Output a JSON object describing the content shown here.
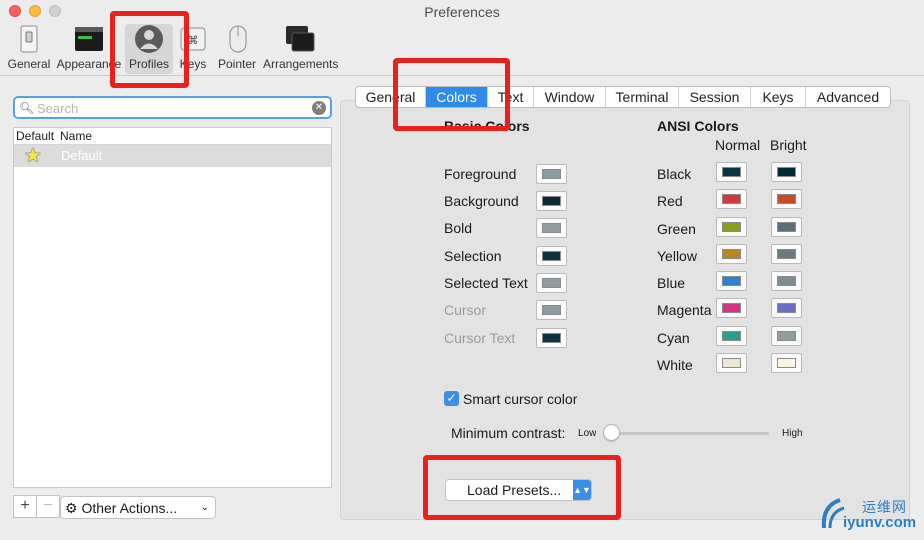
{
  "window": {
    "title": "Preferences"
  },
  "toolbar": {
    "items": [
      {
        "label": "General"
      },
      {
        "label": "Appearance"
      },
      {
        "label": "Profiles"
      },
      {
        "label": "Keys"
      },
      {
        "label": "Pointer"
      },
      {
        "label": "Arrangements"
      }
    ]
  },
  "profiles": {
    "search_placeholder": "Search",
    "columns": [
      "Default",
      "Name"
    ],
    "rows": [
      {
        "name": "Default"
      }
    ],
    "add_label": "+",
    "remove_label": "−",
    "other_actions_label": "Other Actions..."
  },
  "tabs": [
    "General",
    "Colors",
    "Text",
    "Window",
    "Terminal",
    "Session",
    "Keys",
    "Advanced"
  ],
  "active_tab": "Colors",
  "basic_colors": {
    "title": "Basic Colors",
    "items": [
      {
        "label": "Foreground",
        "color": "#8a9aa0"
      },
      {
        "label": "Background",
        "color": "#0b2a36"
      },
      {
        "label": "Bold",
        "color": "#949d9d"
      },
      {
        "label": "Selection",
        "color": "#0c3340"
      },
      {
        "label": "Selected Text",
        "color": "#919c9c"
      },
      {
        "label": "Cursor",
        "color": "#8c9a9e"
      },
      {
        "label": "Cursor Text",
        "color": "#0c3440"
      }
    ]
  },
  "ansi_colors": {
    "title": "ANSI Colors",
    "normal_label": "Normal",
    "bright_label": "Bright",
    "items": [
      {
        "label": "Black",
        "normal": "#0a3542",
        "bright": "#002a36"
      },
      {
        "label": "Red",
        "normal": "#d6383a",
        "bright": "#c84b23"
      },
      {
        "label": "Green",
        "normal": "#879c20",
        "bright": "#5f6e74"
      },
      {
        "label": "Yellow",
        "normal": "#b58a20",
        "bright": "#6b7a80"
      },
      {
        "label": "Blue",
        "normal": "#2f83ce",
        "bright": "#7f8d92"
      },
      {
        "label": "Magenta",
        "normal": "#d23583",
        "bright": "#6d6ec6"
      },
      {
        "label": "Cyan",
        "normal": "#2b9d8f",
        "bright": "#919c9a"
      },
      {
        "label": "White",
        "normal": "#ece6d2",
        "bright": "#fbf5e2"
      }
    ]
  },
  "smart_cursor": {
    "label": "Smart cursor color",
    "checked": true
  },
  "min_contrast": {
    "label": "Minimum contrast:",
    "low": "Low",
    "high": "High",
    "value": 0.0
  },
  "load_presets_label": "Load Presets...",
  "watermark": {
    "line1": "运维网",
    "line2": "iyunv.com"
  },
  "colors": {
    "accent": "#2f8bea",
    "highlight_box": "#e8211c"
  }
}
